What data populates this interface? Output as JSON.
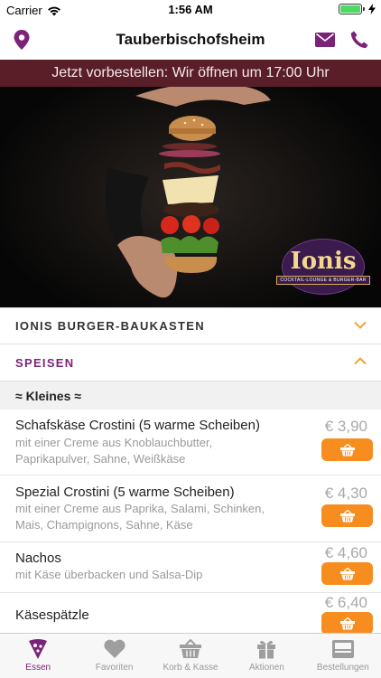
{
  "status_bar": {
    "carrier": "Carrier",
    "time": "1:56 AM"
  },
  "nav": {
    "title": "Tauberbischofsheim"
  },
  "banner": {
    "text": "Jetzt vorbestellen: Wir öffnen um 17:00 Uhr"
  },
  "logo": {
    "name": "Ionis",
    "tagline": "COCKTAIL-LOUNGE & BURGER-BAR"
  },
  "accordion": [
    {
      "title": "IONIS BURGER-BAUKASTEN",
      "state": "collapsed"
    },
    {
      "title": "SPEISEN",
      "state": "expanded"
    }
  ],
  "section": {
    "title": "≈ Kleines ≈"
  },
  "menu_items": [
    {
      "name": "Schafskäse Crostini (5 warme Scheiben)",
      "description_line1": "mit einer Creme aus Knoblauchbutter,",
      "description_line2": "Paprikapulver, Sahne, Weißkäse",
      "price": "€ 3,90"
    },
    {
      "name": "Spezial Crostini (5 warme Scheiben)",
      "description_line1": "mit einer Creme aus Paprika, Salami, Schinken,",
      "description_line2": "Mais, Champignons, Sahne, Käse",
      "price": "€ 4,30"
    },
    {
      "name": "Nachos",
      "description_line1": "mit Käse überbacken und Salsa-Dip",
      "description_line2": "",
      "price": "€ 4,60"
    },
    {
      "name": "Käsespätzle",
      "description_line1": "",
      "description_line2": "",
      "price": "€ 6,40"
    }
  ],
  "tabs": [
    {
      "label": "Essen",
      "icon": "pizza-slice-icon",
      "active": true
    },
    {
      "label": "Favoriten",
      "icon": "heart-icon",
      "active": false
    },
    {
      "label": "Korb & Kasse",
      "icon": "basket-icon",
      "active": false
    },
    {
      "label": "Aktionen",
      "icon": "gift-icon",
      "active": false
    },
    {
      "label": "Bestellungen",
      "icon": "orders-tray-icon",
      "active": false
    }
  ],
  "colors": {
    "accent": "#7a2378",
    "cart_button": "#f78d1f",
    "banner_bg": "#5a1e29",
    "chevron": "#f0a33a"
  }
}
